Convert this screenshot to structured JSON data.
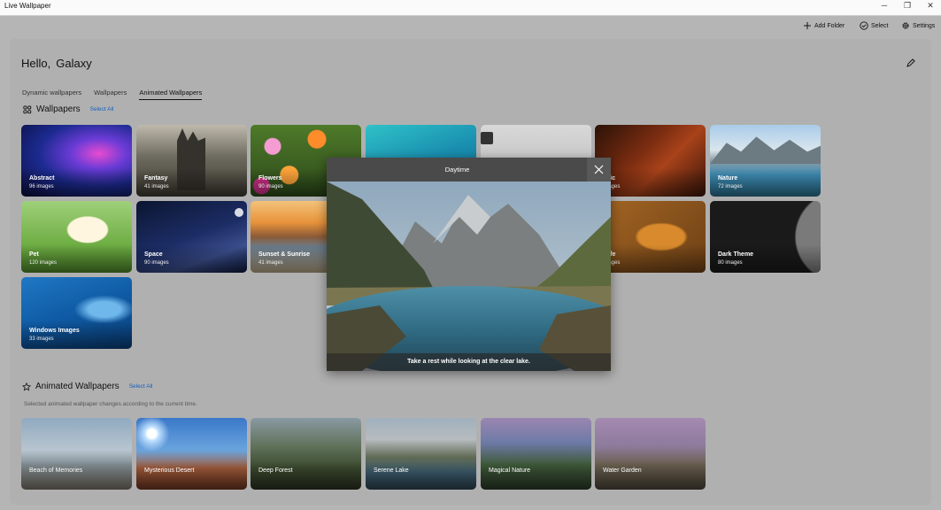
{
  "window": {
    "title": "Live Wallpaper",
    "minimize": "─",
    "restore": "❐",
    "close": "✕"
  },
  "toolbar": {
    "add_folder": "Add Folder",
    "select": "Select",
    "settings": "Settings"
  },
  "greeting": {
    "hello": "Hello,",
    "name": "Galaxy"
  },
  "tabs": [
    {
      "label": "Dynamic wallpapers",
      "active": false
    },
    {
      "label": "Wallpapers",
      "active": false
    },
    {
      "label": "Animated Wallpapers",
      "active": true
    }
  ],
  "wallpapers_section": {
    "title": "Wallpapers",
    "select_all": "Select All"
  },
  "wallpapers": [
    {
      "name": "Abstract",
      "count": "96 images"
    },
    {
      "name": "Fantasy",
      "count": "41 images"
    },
    {
      "name": "Flowers",
      "count": "90 images"
    },
    {
      "name": "",
      "count": ""
    },
    {
      "name": "",
      "count": ""
    },
    {
      "name": "usic",
      "count": "images"
    },
    {
      "name": "Nature",
      "count": "72 images"
    },
    {
      "name": "Pet",
      "count": "120 images"
    },
    {
      "name": "Space",
      "count": "90 images"
    },
    {
      "name": "Sunset & Sunrise",
      "count": "41 images"
    },
    {
      "name": "dlife",
      "count": "images"
    },
    {
      "name": "Dark Theme",
      "count": "80 images"
    },
    {
      "name": "Windows Images",
      "count": "33 images"
    }
  ],
  "animated_section": {
    "title": "Animated Wallpapers",
    "select_all": "Select All",
    "subtitle": "Selected animated wallpaper changes according to the current time."
  },
  "animated": [
    {
      "name": "Beach of Memories"
    },
    {
      "name": "Mysterious Desert"
    },
    {
      "name": "Deep Forest"
    },
    {
      "name": "Serene Lake"
    },
    {
      "name": "Magical Nature"
    },
    {
      "name": "Water Garden"
    }
  ],
  "modal": {
    "title": "Daytime",
    "caption": "Take a rest while looking at the clear lake."
  },
  "colors": {
    "accent": "#1560bd"
  }
}
